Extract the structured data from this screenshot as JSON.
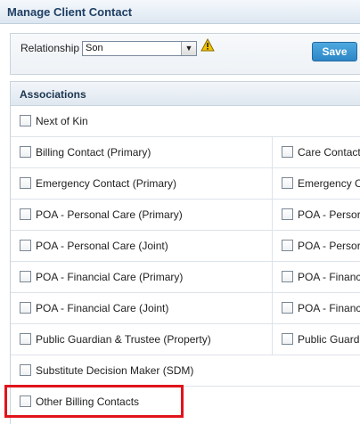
{
  "header": {
    "title": "Manage Client Contact"
  },
  "relationship": {
    "label": "Relationship",
    "selected": "Son",
    "save_label": "Save"
  },
  "associations": {
    "title": "Associations",
    "rows": [
      {
        "left": "Next of Kin",
        "right": ""
      },
      {
        "left": "Billing Contact (Primary)",
        "right": "Care Contact"
      },
      {
        "left": "Emergency Contact (Primary)",
        "right": "Emergency C"
      },
      {
        "left": "POA - Personal Care (Primary)",
        "right": "POA - Persor"
      },
      {
        "left": "POA - Personal Care (Joint)",
        "right": "POA - Persor"
      },
      {
        "left": "POA - Financial Care (Primary)",
        "right": "POA - Financ"
      },
      {
        "left": "POA - Financial Care (Joint)",
        "right": "POA - Financ"
      },
      {
        "left": "Public Guardian & Trustee (Property)",
        "right": "Public Guardi"
      },
      {
        "left": "Substitute Decision Maker (SDM)",
        "right": ""
      },
      {
        "left": "Other Billing Contacts",
        "right": ""
      }
    ]
  },
  "colors": {
    "accent": "#2d86c6",
    "highlight": "#e0141b",
    "warning": "#f2c200"
  }
}
